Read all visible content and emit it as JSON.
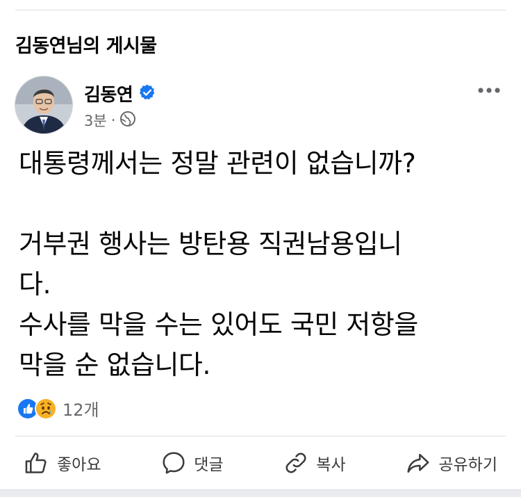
{
  "page": {
    "title": "김동연님의 게시물"
  },
  "post": {
    "author": "김동연",
    "verified": true,
    "time": "3분",
    "separator": "·",
    "audience_icon": "globe-icon",
    "text": "대통령께서는 정말 관련이 없습니까?\n\n거부권 행사는 방탄용 직권남용입니\n다.\n수사를 막을 수는 있어도 국민 저항을\n막을 순 없습니다.",
    "reactions": {
      "types": [
        "like",
        "sad"
      ],
      "count": "12개"
    }
  },
  "actions": {
    "like": "좋아요",
    "comment": "댓글",
    "copy": "복사",
    "share": "공유하기"
  },
  "colors": {
    "accent": "#1877f2",
    "text": "#050505",
    "muted": "#65676b",
    "divider": "#dadde1"
  }
}
